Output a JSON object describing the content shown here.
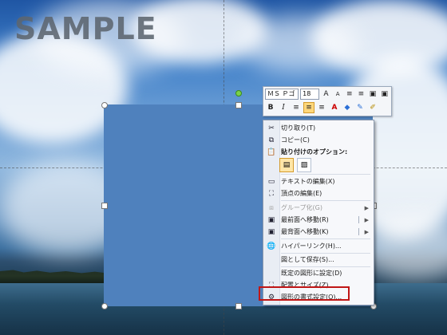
{
  "watermark": "SAMPLE",
  "mini_toolbar": {
    "font_name": "ＭＳ Ｐゴ",
    "font_size": "18",
    "row1_icons": [
      "grow-font-icon",
      "shrink-font-icon",
      "decrease-indent-icon",
      "increase-indent-icon",
      "bring-forward-icon",
      "send-backward-icon"
    ],
    "row2_icons": [
      "bold-icon",
      "italic-icon",
      "align-left-icon",
      "align-center-icon",
      "align-right-icon",
      "font-color-icon",
      "fill-color-icon",
      "line-color-icon",
      "format-painter-icon"
    ],
    "bold": "B",
    "italic": "I"
  },
  "context_menu": {
    "items": [
      {
        "label": "切り取り(T)",
        "icon": "scissors-icon",
        "enabled": true
      },
      {
        "label": "コピー(C)",
        "icon": "copy-icon",
        "enabled": true
      },
      {
        "label": "貼り付けのオプション:",
        "icon": "paste-icon",
        "enabled": true,
        "bold": true
      },
      {
        "label": "テキストの編集(X)",
        "icon": "edit-text-icon",
        "enabled": true
      },
      {
        "label": "頂点の編集(E)",
        "icon": "edit-points-icon",
        "enabled": true
      },
      {
        "label": "グループ化(G)",
        "icon": "group-icon",
        "enabled": false,
        "submenu": true
      },
      {
        "label": "最前面へ移動(R)",
        "icon": "bring-to-front-icon",
        "enabled": true,
        "submenu": true
      },
      {
        "label": "最背面へ移動(K)",
        "icon": "send-to-back-icon",
        "enabled": true,
        "submenu": true
      },
      {
        "label": "ハイパーリンク(H)...",
        "icon": "hyperlink-icon",
        "enabled": true
      },
      {
        "label": "図として保存(S)...",
        "icon": "",
        "enabled": true
      },
      {
        "label": "既定の図形に設定(D)",
        "icon": "",
        "enabled": true
      },
      {
        "label": "配置とサイズ(Z)...",
        "icon": "size-position-icon",
        "enabled": true
      },
      {
        "label": "図形の書式設定(O)...",
        "icon": "format-shape-icon",
        "enabled": true,
        "highlighted": true
      }
    ],
    "paste_option_icons": [
      "paste-keep-source-icon",
      "paste-picture-icon"
    ]
  }
}
